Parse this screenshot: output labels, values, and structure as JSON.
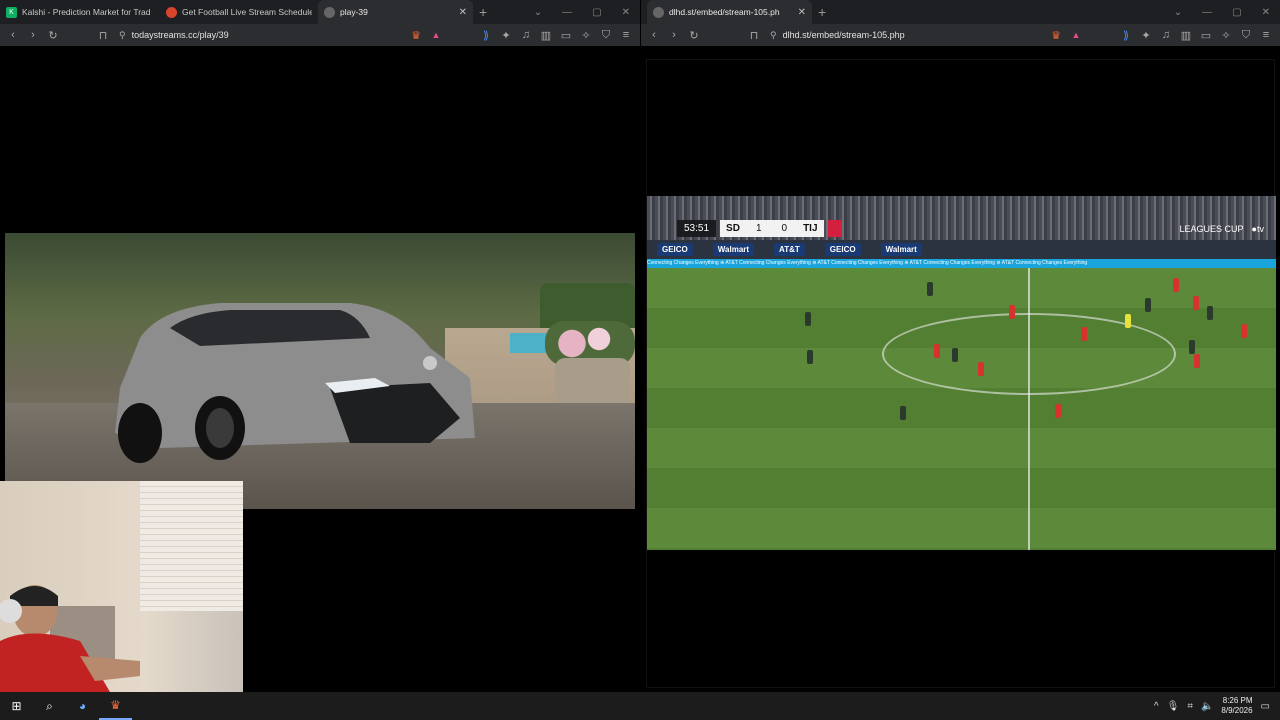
{
  "left_browser": {
    "tabs": [
      {
        "label": "Kalshi - Prediction Market for Trad",
        "favicon": "K",
        "favicon_color": "#0fae62",
        "active": false
      },
      {
        "label": "Get Football Live Stream Schedule",
        "favicon": "⚽",
        "favicon_color": "#d8452c",
        "active": false
      },
      {
        "label": "play-39",
        "favicon": "●",
        "favicon_color": "#666666",
        "active": true
      }
    ],
    "url": "todaystreams.cc/play/39"
  },
  "right_browser": {
    "tabs": [
      {
        "label": "dlhd.st/embed/stream-105.ph",
        "favicon": "●",
        "favicon_color": "#666666",
        "active": true
      }
    ],
    "url": "dlhd.st/embed/stream-105.php"
  },
  "scorebug": {
    "clock": "53:51",
    "home_team": "SD",
    "home_score": "1",
    "away_score": "0",
    "away_team": "TIJ",
    "away_color": "#d51f3f"
  },
  "ad_boards": [
    "GEICO",
    "Walmart",
    "AT&T",
    "GEICO",
    "Walmart"
  ],
  "ribbon_text": "Connecting Changes Everything  ⊛ AT&T  Connecting Changes Everything  ⊛ AT&T  Connecting Changes Everything  ⊛ AT&T  Connecting Changes Everything  ⊛ AT&T  Connecting Changes Everything",
  "broadcast": {
    "league": "LEAGUES CUP",
    "network": "tv"
  },
  "taskbar": {
    "time": "8:26 PM",
    "date": "8/9/2026"
  }
}
